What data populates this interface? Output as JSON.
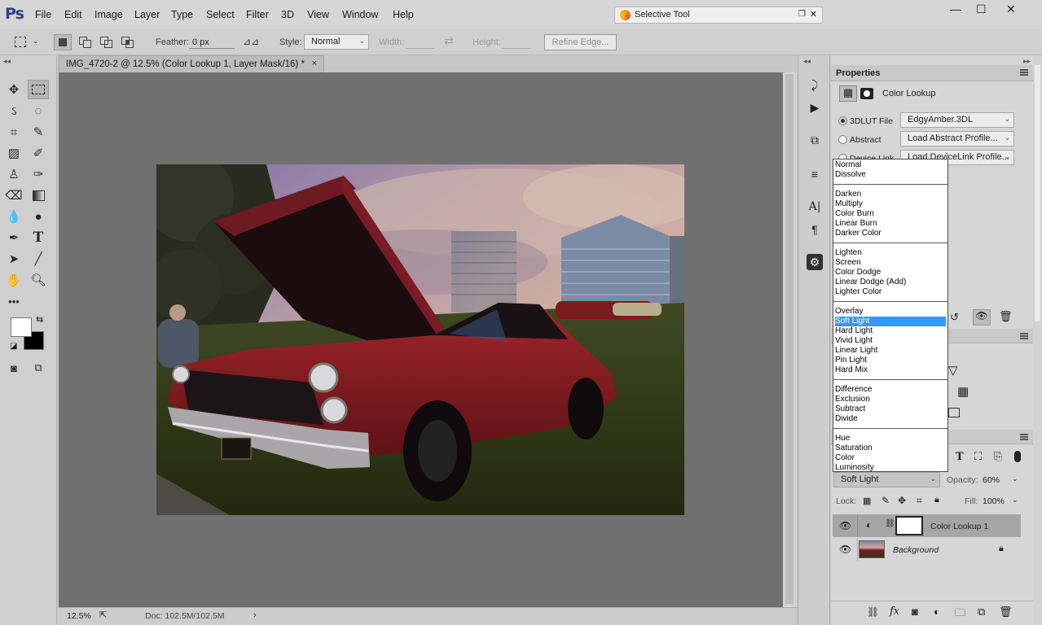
{
  "app": {
    "logo": "Ps"
  },
  "menu": [
    "File",
    "Edit",
    "Image",
    "Layer",
    "Type",
    "Select",
    "Filter",
    "3D",
    "View",
    "Window",
    "Help"
  ],
  "selective_tool": {
    "title": "Selective Tool"
  },
  "options": {
    "feather_label": "Feather:",
    "feather_value": "0 px",
    "style_label": "Style:",
    "style_value": "Normal",
    "width_label": "Width:",
    "height_label": "Height:",
    "refine_label": "Refine Edge..."
  },
  "document": {
    "tab_title": "IMG_4720-2 @ 12.5% (Color Lookup 1, Layer Mask/16) *",
    "close": "×",
    "zoom": "12.5%",
    "doc_info": "Doc: 102.5M/102.5M"
  },
  "properties": {
    "title": "Properties",
    "panel_name": "Color Lookup",
    "lut_label": "3DLUT File",
    "lut_value": "EdgyAmber.3DL",
    "abstract_label": "Abstract",
    "abstract_value": "Load Abstract Profile...",
    "devicelink_label": "Device Link",
    "devicelink_value": "Load DeviceLink Profile..."
  },
  "blend_modes": {
    "groups": [
      [
        "Normal",
        "Dissolve"
      ],
      [
        "Darken",
        "Multiply",
        "Color Burn",
        "Linear Burn",
        "Darker Color"
      ],
      [
        "Lighten",
        "Screen",
        "Color Dodge",
        "Linear Dodge (Add)",
        "Lighter Color"
      ],
      [
        "Overlay",
        "Soft Light",
        "Hard Light",
        "Vivid Light",
        "Linear Light",
        "Pin Light",
        "Hard Mix"
      ],
      [
        "Difference",
        "Exclusion",
        "Subtract",
        "Divide"
      ],
      [
        "Hue",
        "Saturation",
        "Color",
        "Luminosity"
      ]
    ],
    "selected": "Soft Light"
  },
  "layers": {
    "blend_value": "Soft Light",
    "opacity_label": "Opacity:",
    "opacity_value": "60%",
    "lock_label": "Lock:",
    "fill_label": "Fill:",
    "fill_value": "100%",
    "items": [
      {
        "name": "Color Lookup 1"
      },
      {
        "name": "Background"
      }
    ]
  },
  "colors": {
    "accent": "#3399ff",
    "ps_blue": "#2d3f8a",
    "car_red": "#8a1c22"
  }
}
